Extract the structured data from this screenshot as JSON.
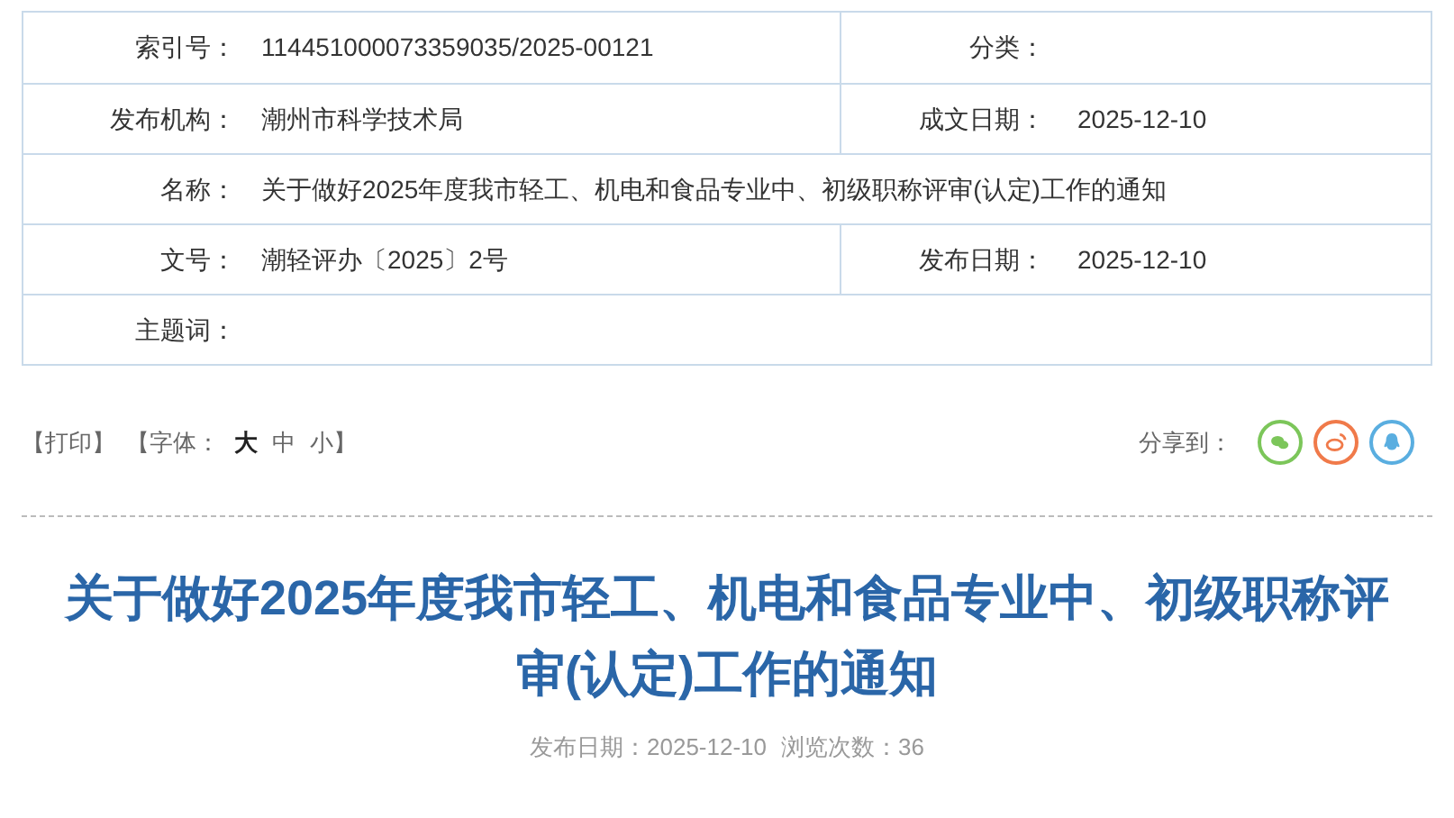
{
  "info_table": {
    "rows": [
      {
        "cells": [
          {
            "label": "索引号：",
            "value": "114451000073359035/2025-00121"
          },
          {
            "label": "分类："
          }
        ]
      },
      {
        "cells": [
          {
            "label": "发布机构：",
            "value": "潮州市科学技术局"
          },
          {
            "label": "成文日期：",
            "value": "2025-12-10"
          }
        ]
      },
      {
        "cells": [
          {
            "label": "名称：",
            "value": "关于做好2025年度我市轻工、机电和食品专业中、初级职称评审(认定)工作的通知"
          }
        ]
      },
      {
        "cells": [
          {
            "label": "文号：",
            "value": "潮轻评办〔2025〕2号"
          },
          {
            "label": "发布日期：",
            "value": "2025-12-10"
          }
        ]
      },
      {
        "cells": [
          {
            "label": "主题词："
          }
        ]
      }
    ]
  },
  "toolbar": {
    "print": "【打印】",
    "font_open": "【字体：",
    "font_sizes": [
      {
        "label": "大",
        "selected": true
      },
      {
        "label": "中",
        "selected": false
      },
      {
        "label": "小",
        "selected": false
      }
    ],
    "font_close": "】",
    "share_label": "分享到：",
    "share": [
      {
        "kind": "wechat",
        "color": "#7cc65a"
      },
      {
        "kind": "weibo",
        "color": "#f07a4a"
      },
      {
        "kind": "qq",
        "color": "#5aaee0"
      }
    ]
  },
  "article": {
    "title": "关于做好2025年度我市轻工、机电和食品专业中、初级职称评审(认定)工作的通知",
    "meta": [
      "发布日期：2025-12-10",
      "浏览次数：36"
    ]
  }
}
